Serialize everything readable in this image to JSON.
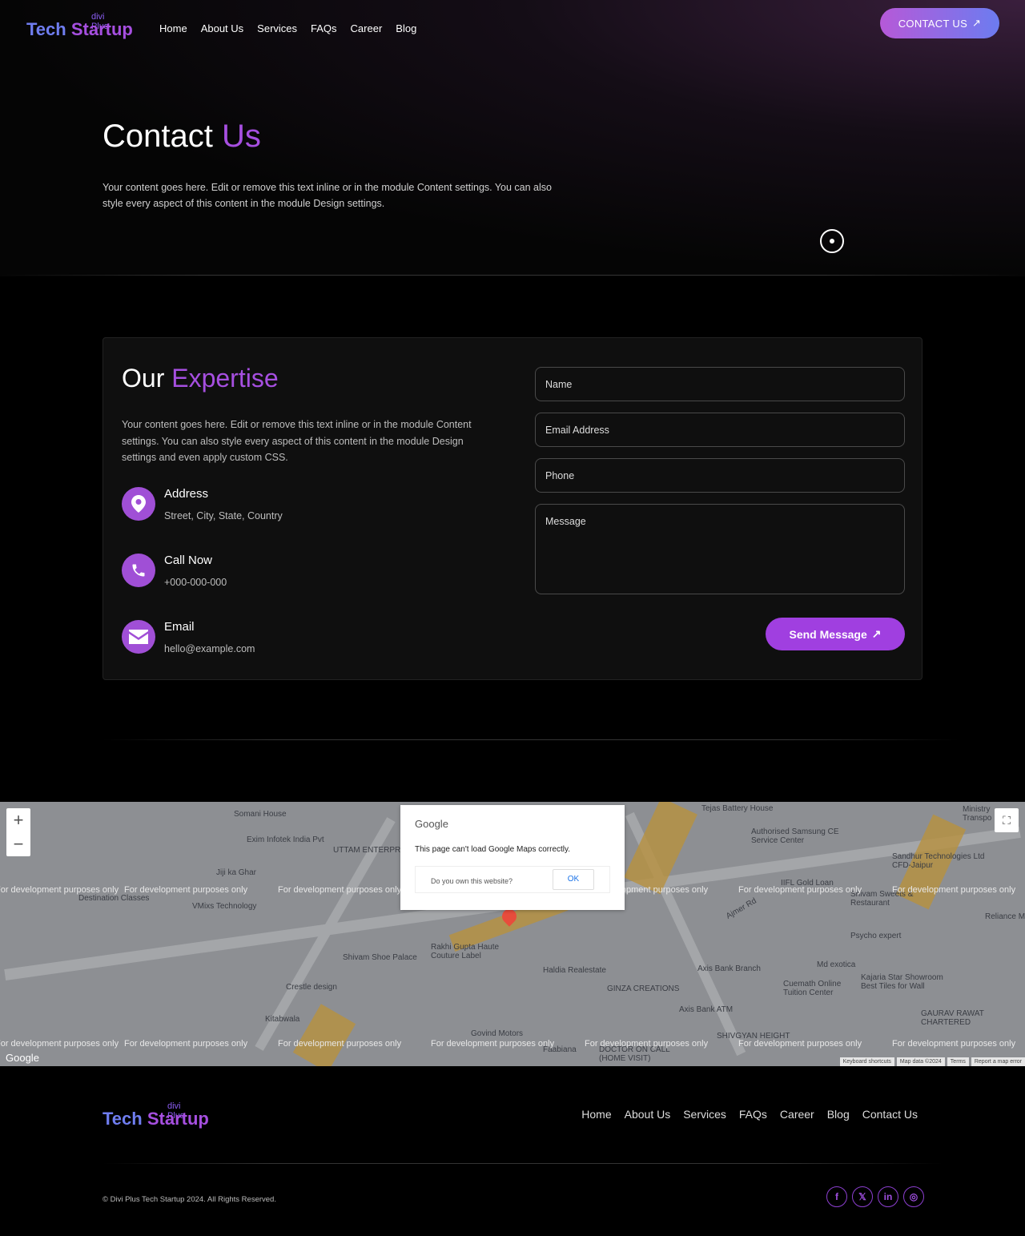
{
  "header": {
    "logo": {
      "small": "divi Plus",
      "word1": "Tech",
      "word2": "Startup"
    },
    "nav": [
      "Home",
      "About Us",
      "Services",
      "FAQs",
      "Career",
      "Blog"
    ],
    "cta": "CONTACT US"
  },
  "hero": {
    "title_a": "Contact",
    "title_b": "Us",
    "text": "Your content goes here. Edit or remove this text inline or in the module Content settings. You can also style every aspect of this content in the module Design settings."
  },
  "expertise": {
    "title_a": "Our",
    "title_b": "Expertise",
    "text": "Your content goes here. Edit or remove this text inline or in the module Content settings. You can also style every aspect of this content in the module Design settings and even apply custom CSS.",
    "items": [
      {
        "icon": "map-pin-icon",
        "title": "Address",
        "sub": "Street, City, State, Country"
      },
      {
        "icon": "phone-icon",
        "title": "Call Now",
        "sub": "+000-000-000"
      },
      {
        "icon": "envelope-icon",
        "title": "Email",
        "sub": "hello@example.com"
      }
    ]
  },
  "form": {
    "name_placeholder": "Name",
    "email_placeholder": "Email Address",
    "phone_placeholder": "Phone",
    "message_placeholder": "Message",
    "submit": "Send Message"
  },
  "map": {
    "dialog": {
      "brand": "Google",
      "message": "This page can't load Google Maps correctly.",
      "question": "Do you own this website?",
      "ok": "OK"
    },
    "dev_label": "For development purposes only",
    "labels": [
      "Somani House",
      "Exim Infotek India Pvt",
      "UTTAM ENTERPR",
      "Jiji ka Ghar",
      "Destination Classes",
      "VMixs Technology",
      "Tejas Battery House",
      "Authorised Samsung CE Service Center",
      "Sandhur Technologies Ltd CFD-Jaipur",
      "IIFL Gold Loan",
      "Shivam Sweets & Restaurant",
      "Ajmer Rd",
      "Psycho expert",
      "Rakhi Gupta Haute Couture Label",
      "Shivam Shoe Palace",
      "Haldia Realestate",
      "GINZA CREATIONS",
      "Axis Bank Branch",
      "Axis Bank ATM",
      "Md exotica",
      "Cuemath Online Tuition Center",
      "Kajaria Star Showroom Best Tiles for Wall",
      "GAURAV RAWAT CHARTERED",
      "Crestle design",
      "Kitabwala",
      "Govind Motors",
      "Faabiana",
      "DOCTOR ON CALL (HOME VISIT)",
      "SHIVGYAN HEIGHT",
      "Reliance Master Ca",
      "Ministry Transpo"
    ],
    "google": "Google",
    "attribution": [
      "Keyboard shortcuts",
      "Map data ©2024",
      "Terms",
      "Report a map error"
    ]
  },
  "footer": {
    "nav": [
      "Home",
      "About Us",
      "Services",
      "FAQs",
      "Career",
      "Blog",
      "Contact Us"
    ],
    "copyright": "© Divi Plus Tech Startup 2024. All Rights Reserved.",
    "social": [
      {
        "icon": "facebook-icon",
        "glyph": "f"
      },
      {
        "icon": "x-icon",
        "glyph": "𝕏"
      },
      {
        "icon": "linkedin-icon",
        "glyph": "in"
      },
      {
        "icon": "instagram-icon",
        "glyph": "◎"
      }
    ]
  },
  "colors": {
    "accent": "#a64fe0",
    "icon_bg": "#a04fd6",
    "button": "#a03fe0"
  }
}
